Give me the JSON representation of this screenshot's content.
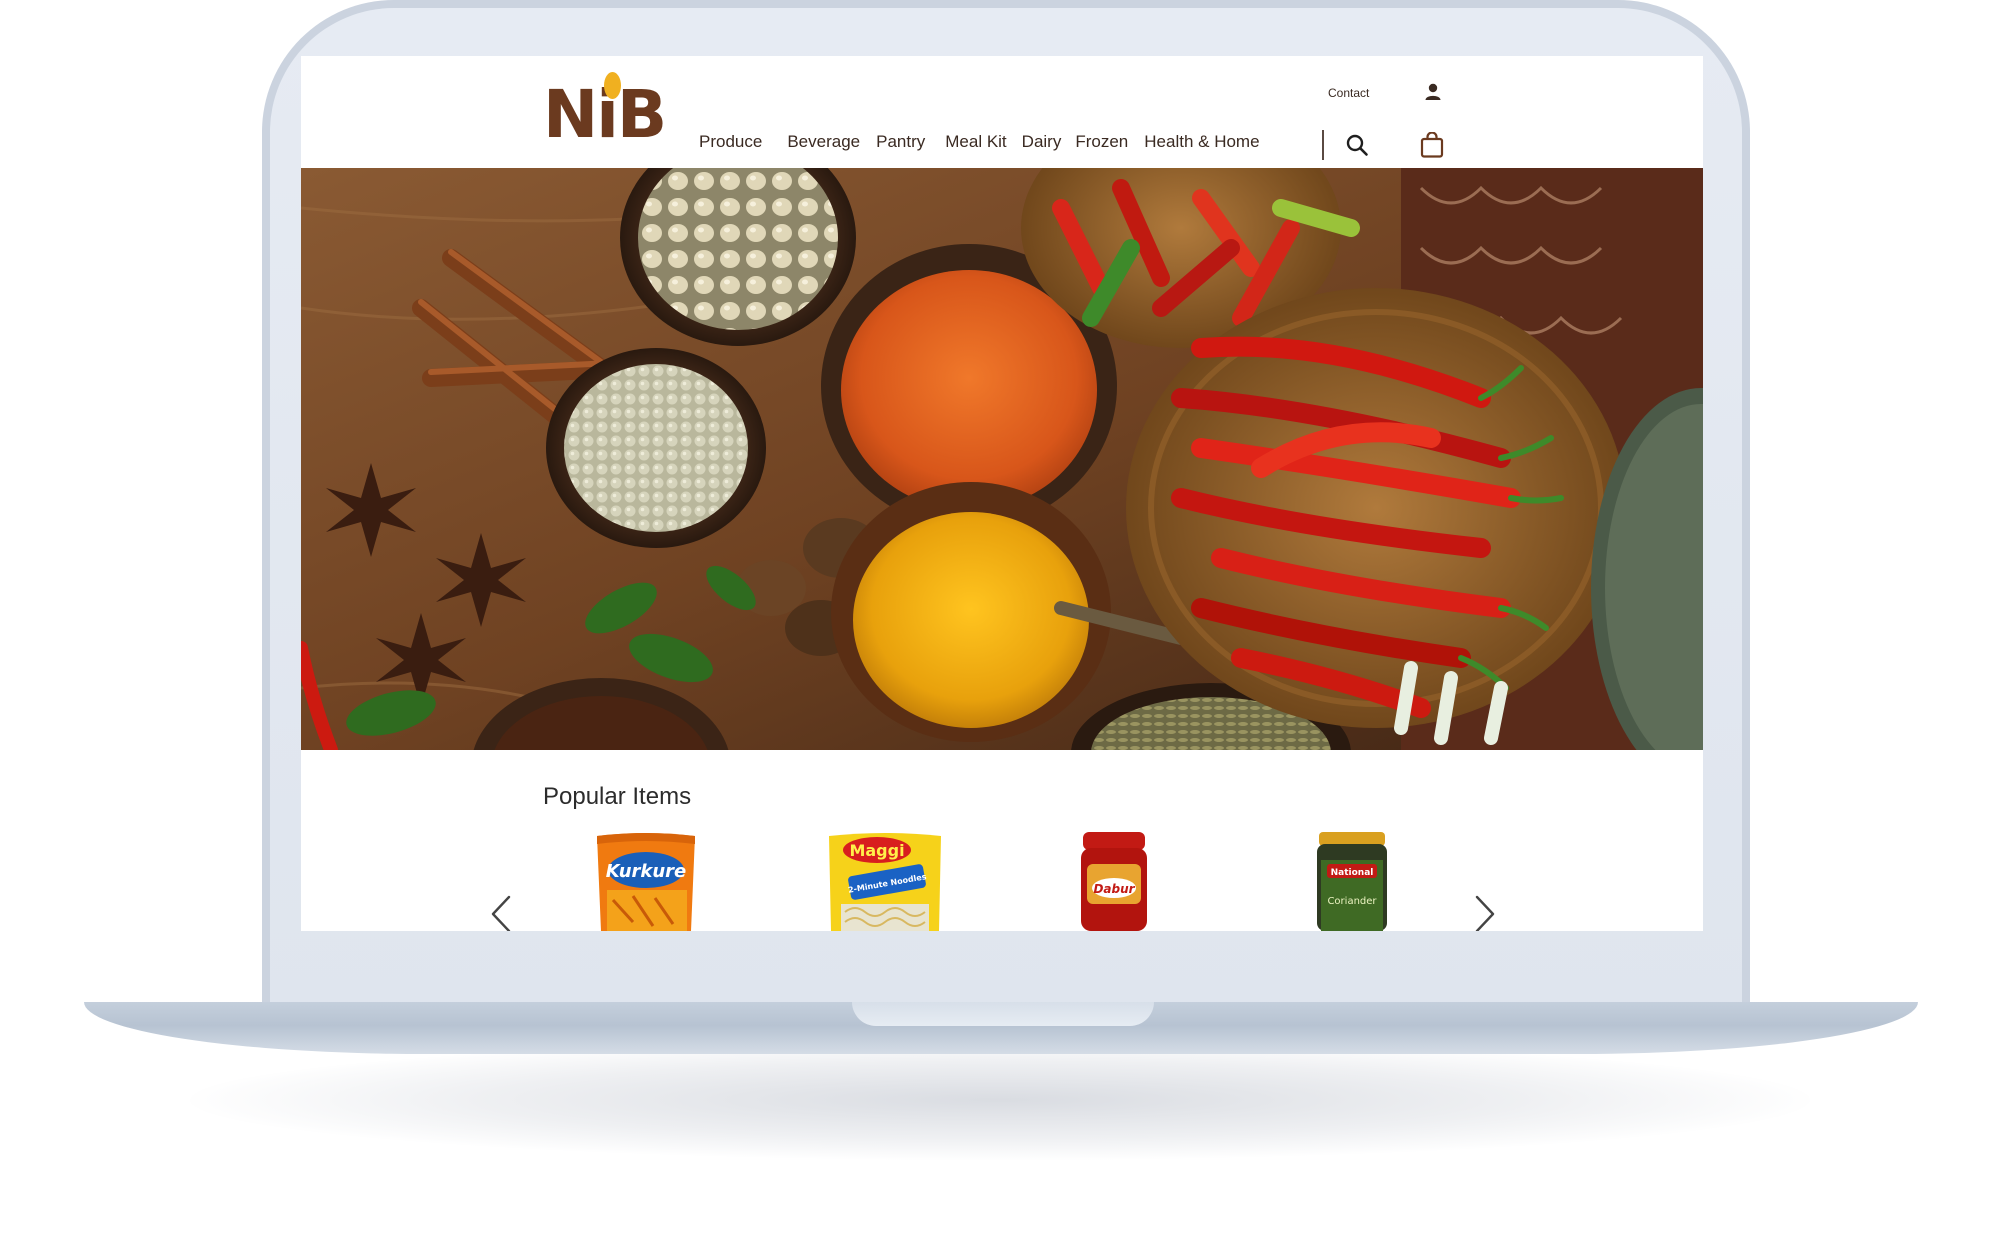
{
  "brand": {
    "logo_text": "NiB",
    "primary_color": "#6b3a1f",
    "accent_color": "#f0b020"
  },
  "header": {
    "contact_label": "Contact",
    "icons": [
      "user-icon",
      "search-icon",
      "shopping-bag-icon"
    ]
  },
  "nav": {
    "items": [
      "Produce",
      "Beverage",
      "Pantry",
      "Meal Kit",
      "Dairy",
      "Frozen",
      "Health & Home"
    ]
  },
  "hero": {
    "image": "spices-and-chillies"
  },
  "popular": {
    "title": "Popular Items",
    "products": [
      {
        "brand_text": "Kurkure",
        "image": "kurkure-snack-pack"
      },
      {
        "brand_text": "Maggi",
        "subtitle_text": "2-Minute Noodles",
        "image": "maggi-noodles-pack"
      },
      {
        "brand_text": "Dabur",
        "image": "dabur-jar"
      },
      {
        "brand_text": "National",
        "subtitle_text": "Coriander",
        "image": "national-coriander-jar"
      }
    ],
    "prev_icon": "chevron-left-icon",
    "next_icon": "chevron-right-icon"
  }
}
